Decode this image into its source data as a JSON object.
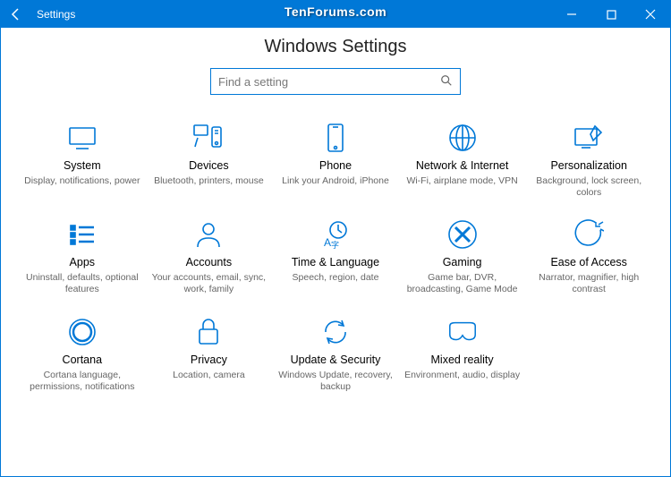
{
  "titlebar": {
    "app_title": "Settings"
  },
  "watermark": "TenForums.com",
  "page": {
    "heading": "Windows Settings",
    "search_placeholder": "Find a setting"
  },
  "tiles": [
    {
      "label": "System",
      "desc": "Display, notifications, power"
    },
    {
      "label": "Devices",
      "desc": "Bluetooth, printers, mouse"
    },
    {
      "label": "Phone",
      "desc": "Link your Android, iPhone"
    },
    {
      "label": "Network & Internet",
      "desc": "Wi-Fi, airplane mode, VPN"
    },
    {
      "label": "Personalization",
      "desc": "Background, lock screen, colors"
    },
    {
      "label": "Apps",
      "desc": "Uninstall, defaults, optional features"
    },
    {
      "label": "Accounts",
      "desc": "Your accounts, email, sync, work, family"
    },
    {
      "label": "Time & Language",
      "desc": "Speech, region, date"
    },
    {
      "label": "Gaming",
      "desc": "Game bar, DVR, broadcasting, Game Mode"
    },
    {
      "label": "Ease of Access",
      "desc": "Narrator, magnifier, high contrast"
    },
    {
      "label": "Cortana",
      "desc": "Cortana language, permissions, notifications"
    },
    {
      "label": "Privacy",
      "desc": "Location, camera"
    },
    {
      "label": "Update & Security",
      "desc": "Windows Update, recovery, backup"
    },
    {
      "label": "Mixed reality",
      "desc": "Environment, audio, display"
    }
  ]
}
